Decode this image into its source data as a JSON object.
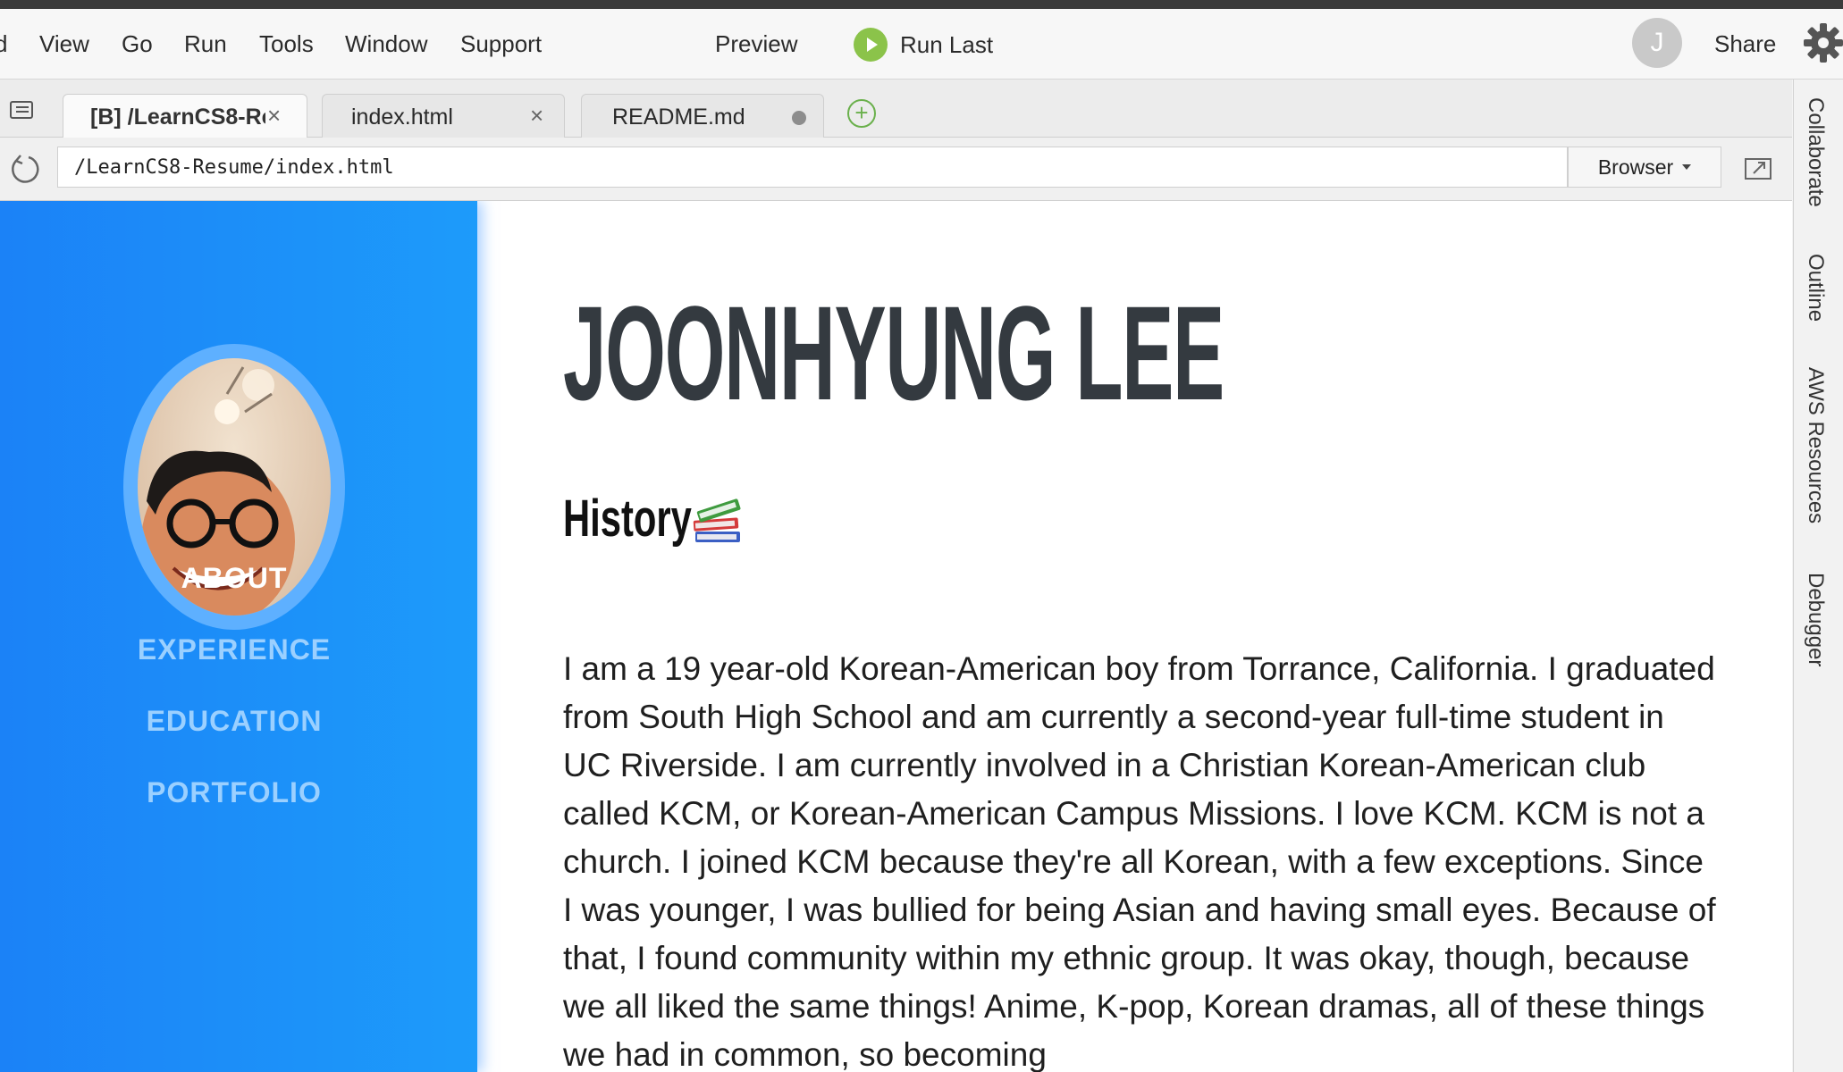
{
  "menubar": {
    "items": [
      "d",
      "View",
      "Go",
      "Run",
      "Tools",
      "Window",
      "Support"
    ],
    "preview_label": "Preview",
    "run_last_label": "Run Last",
    "user_initial": "J",
    "share_label": "Share"
  },
  "tabs": [
    {
      "label": "[B] /LearnCS8-Re",
      "active": true,
      "close": "×"
    },
    {
      "label": "index.html",
      "active": false,
      "close": "×"
    },
    {
      "label": "README.md",
      "active": false,
      "unsaved": true
    }
  ],
  "address": {
    "url": "/LearnCS8-Resume/index.html",
    "browser_label": "Browser"
  },
  "right_panel": [
    "Collaborate",
    "Outline",
    "AWS Resources",
    "Debugger"
  ],
  "page": {
    "nav": [
      "ABOUT",
      "EXPERIENCE",
      "EDUCATION",
      "PORTFOLIO"
    ],
    "active_nav": "ABOUT",
    "name": "JOONHYUNG LEE",
    "section_title": "History",
    "section_emoji": "books-icon",
    "bio": "I am a 19 year-old Korean-American boy from Torrance, California. I graduated from South High School and am currently a second-year full-time student in UC Riverside. I am currently involved in a Christian Korean-American club called KCM, or Korean-American Campus Missions. I love KCM. KCM is not a church. I joined KCM because they're all Korean, with a few exceptions. Since I was younger, I was bullied for being Asian and having small eyes. Because of that, I found community within my ethnic group. It was okay, though, because we all liked the same things! Anime, K-pop, Korean dramas, all of these things we had in common, so becoming"
  },
  "colors": {
    "sidebar": "#1d8ff8",
    "nav_active": "#ffffff",
    "nav_inactive": "#9bd0ff",
    "run_green": "#8bc34a",
    "name_color": "#343a40"
  }
}
